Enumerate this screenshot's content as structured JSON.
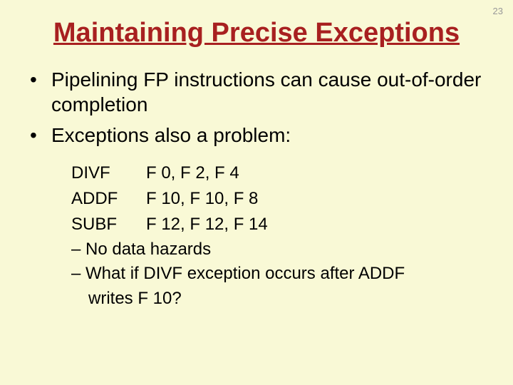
{
  "slideNumber": "23",
  "title": "Maintaining Precise Exceptions",
  "bullets": [
    "Pipelining FP instructions can cause out-of-order completion",
    "Exceptions also a problem:"
  ],
  "code": [
    {
      "op": "DIVF",
      "args": "F 0, F 2, F 4"
    },
    {
      "op": "ADDF",
      "args": "F 10, F 10, F 8"
    },
    {
      "op": "SUBF",
      "args": "F 12, F 12, F 14"
    }
  ],
  "notes": [
    "– No data hazards",
    "– What if DIVF exception occurs after ADDF",
    "writes F 10?"
  ]
}
